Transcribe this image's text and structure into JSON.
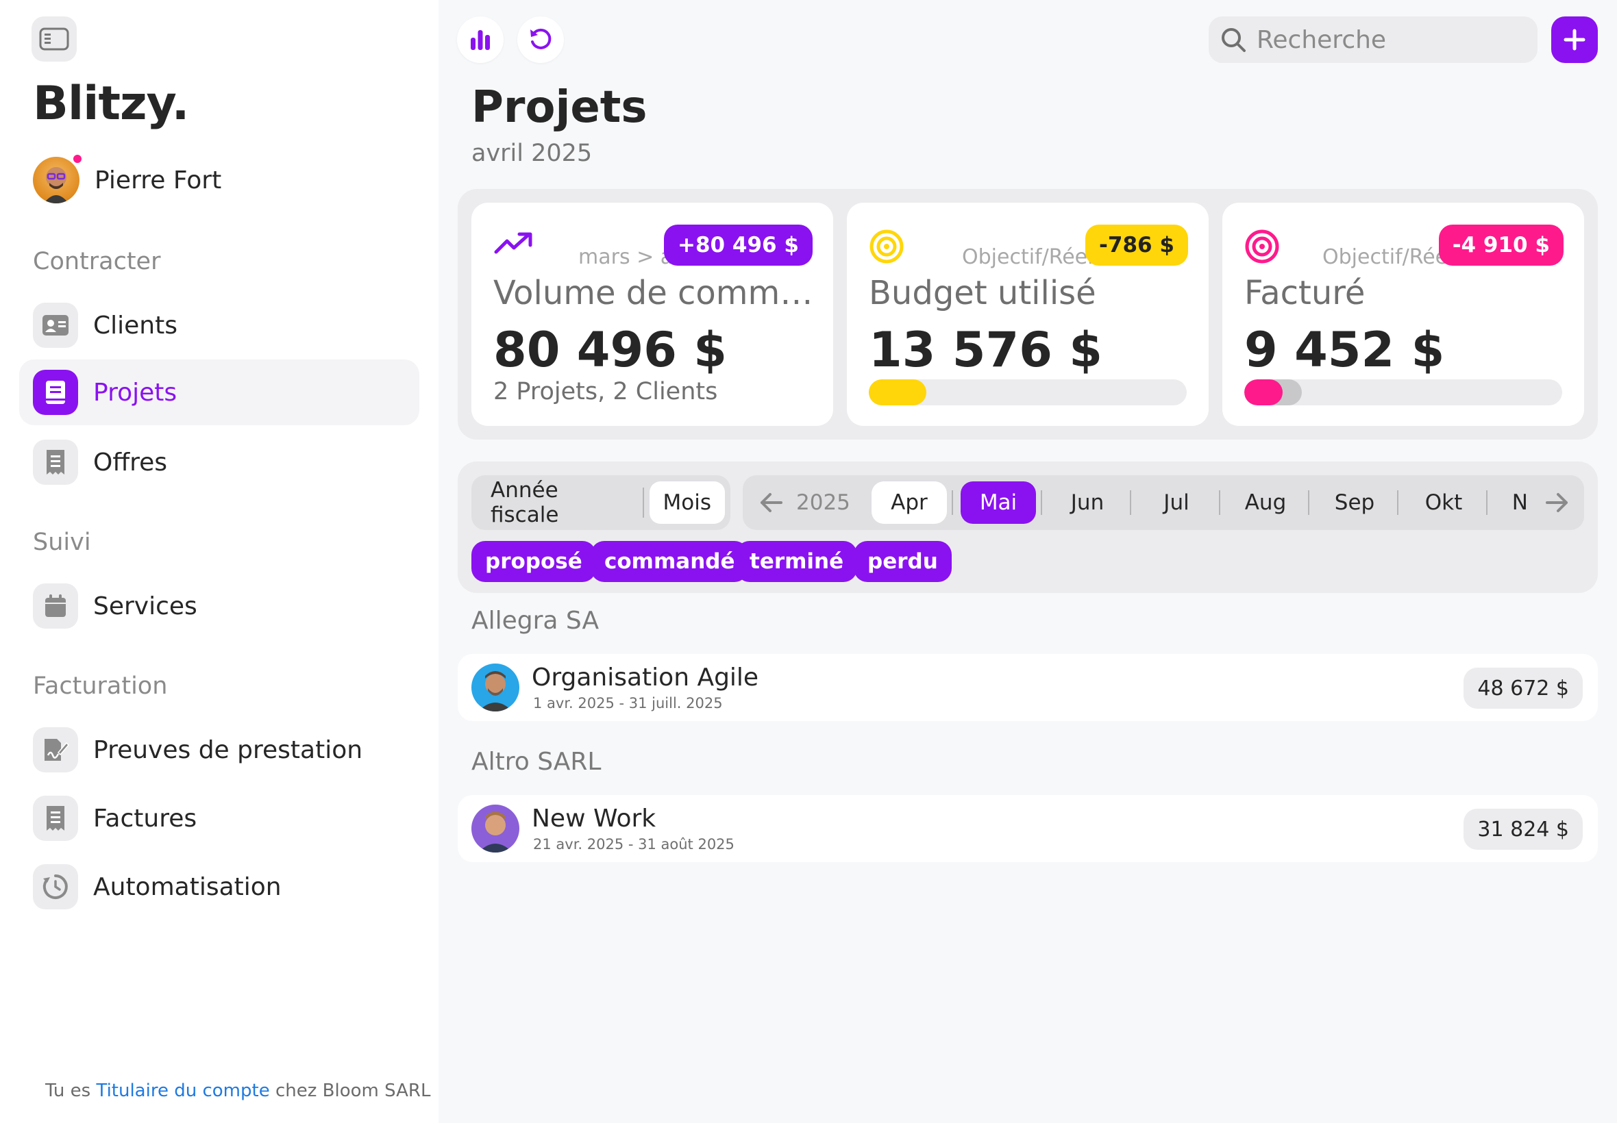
{
  "app": {
    "brand": "Blitzy."
  },
  "user": {
    "name": "Pierre Fort"
  },
  "sidebar": {
    "sections": [
      {
        "label": "Contracter"
      },
      {
        "label": "Suivi"
      },
      {
        "label": "Facturation"
      }
    ],
    "items": [
      {
        "label": "Clients",
        "icon": "contact-card-icon"
      },
      {
        "label": "Projets",
        "icon": "book-icon",
        "active": true
      },
      {
        "label": "Offres",
        "icon": "receipt-icon"
      },
      {
        "label": "Services",
        "icon": "calendar-icon"
      },
      {
        "label": "Preuves de prestation",
        "icon": "signature-icon"
      },
      {
        "label": "Factures",
        "icon": "invoice-icon"
      },
      {
        "label": "Automatisation",
        "icon": "clock-refresh-icon"
      }
    ],
    "footer": {
      "prefix": "Tu es",
      "role_link": "Titulaire du compte",
      "suffix": "chez Bloom SARL"
    }
  },
  "search": {
    "placeholder": "Recherche"
  },
  "page": {
    "title": "Projets",
    "subtitle": "avril 2025"
  },
  "stats": [
    {
      "caption": "mars > avr.",
      "badge": "+80 496 $",
      "label": "Volume de commandes",
      "value": "80 496 $",
      "note": "2 Projets, 2 Clients",
      "accent": "#8a12f0"
    },
    {
      "caption": "Objectif/Réel",
      "badge": "-786 $",
      "label": "Budget utilisé",
      "value": "13 576 $",
      "progress": 0.18,
      "accent": "#ffd60a"
    },
    {
      "caption": "Objectif/Réel",
      "badge": "-4 910 $",
      "label": "Facturé",
      "value": "9 452 $",
      "progress": 0.12,
      "accent": "#ff1a8c"
    }
  ],
  "period": {
    "modes": [
      "Année fiscale",
      "Mois"
    ],
    "active_mode": "Mois",
    "year": "2025",
    "months": [
      "Apr",
      "Mai",
      "Jun",
      "Jul",
      "Aug",
      "Sep",
      "Okt",
      "Nov"
    ],
    "current_month": "Apr",
    "selected_month": "Mai"
  },
  "status_filters": [
    "proposé",
    "commandé",
    "terminé",
    "perdu"
  ],
  "groups": [
    {
      "client": "Allegra SA",
      "projects": [
        {
          "name": "Organisation Agile",
          "dates": "1 avr. 2025 - 31 juill. 2025",
          "amount": "48 672 $"
        }
      ]
    },
    {
      "client": "Altro SARL",
      "projects": [
        {
          "name": "New Work",
          "dates": "21 avr. 2025 - 31 août 2025",
          "amount": "31 824 $"
        }
      ]
    }
  ],
  "colors": {
    "accent": "#8a12f0",
    "yellow": "#ffd60a",
    "pink": "#ff1a8c"
  }
}
